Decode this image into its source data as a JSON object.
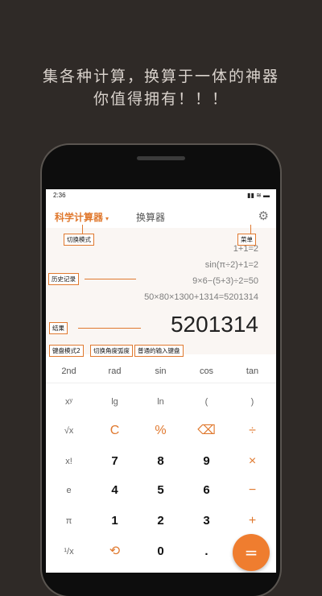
{
  "headline": {
    "line1": "集各种计算，换算于一体的神器",
    "line2": "你值得拥有！！！"
  },
  "status": {
    "time": "2:36",
    "icons": "▮▮ ≋ ▬"
  },
  "appbar": {
    "tab_scientific": "科学计算器",
    "caret": "▾",
    "tab_converter": "换算器",
    "settings_icon": "⚙"
  },
  "history": [
    "1+1=2",
    "sin(π÷2)+1=2",
    "9×6−(5+3)÷2=50",
    "50×80×1300+1314=5201314"
  ],
  "result": "5201314",
  "annotations": {
    "switch_mode": "切换模式",
    "menu": "菜单",
    "history": "历史记录",
    "result": "结果",
    "keyboard_mode": "键盘模式2",
    "angle_unit": "切换角度弧度",
    "normal_input": "普通的输入键盘"
  },
  "func_row": [
    "2nd",
    "rad",
    "sin",
    "cos",
    "tan"
  ],
  "keys": [
    [
      "xʸ",
      "lg",
      "ln",
      "(",
      ")"
    ],
    [
      "√x",
      "C",
      "%",
      "⌫",
      "÷"
    ],
    [
      "x!",
      "7",
      "8",
      "9",
      "×"
    ],
    [
      "e",
      "4",
      "5",
      "6",
      "−"
    ],
    [
      "π",
      "1",
      "2",
      "3",
      "+"
    ],
    [
      "¹/x",
      "⟲",
      "0",
      ".",
      "="
    ]
  ],
  "colors": {
    "accent": "#ef7d2f",
    "background": "#2f2a27",
    "display_bg": "#faf6f3"
  }
}
